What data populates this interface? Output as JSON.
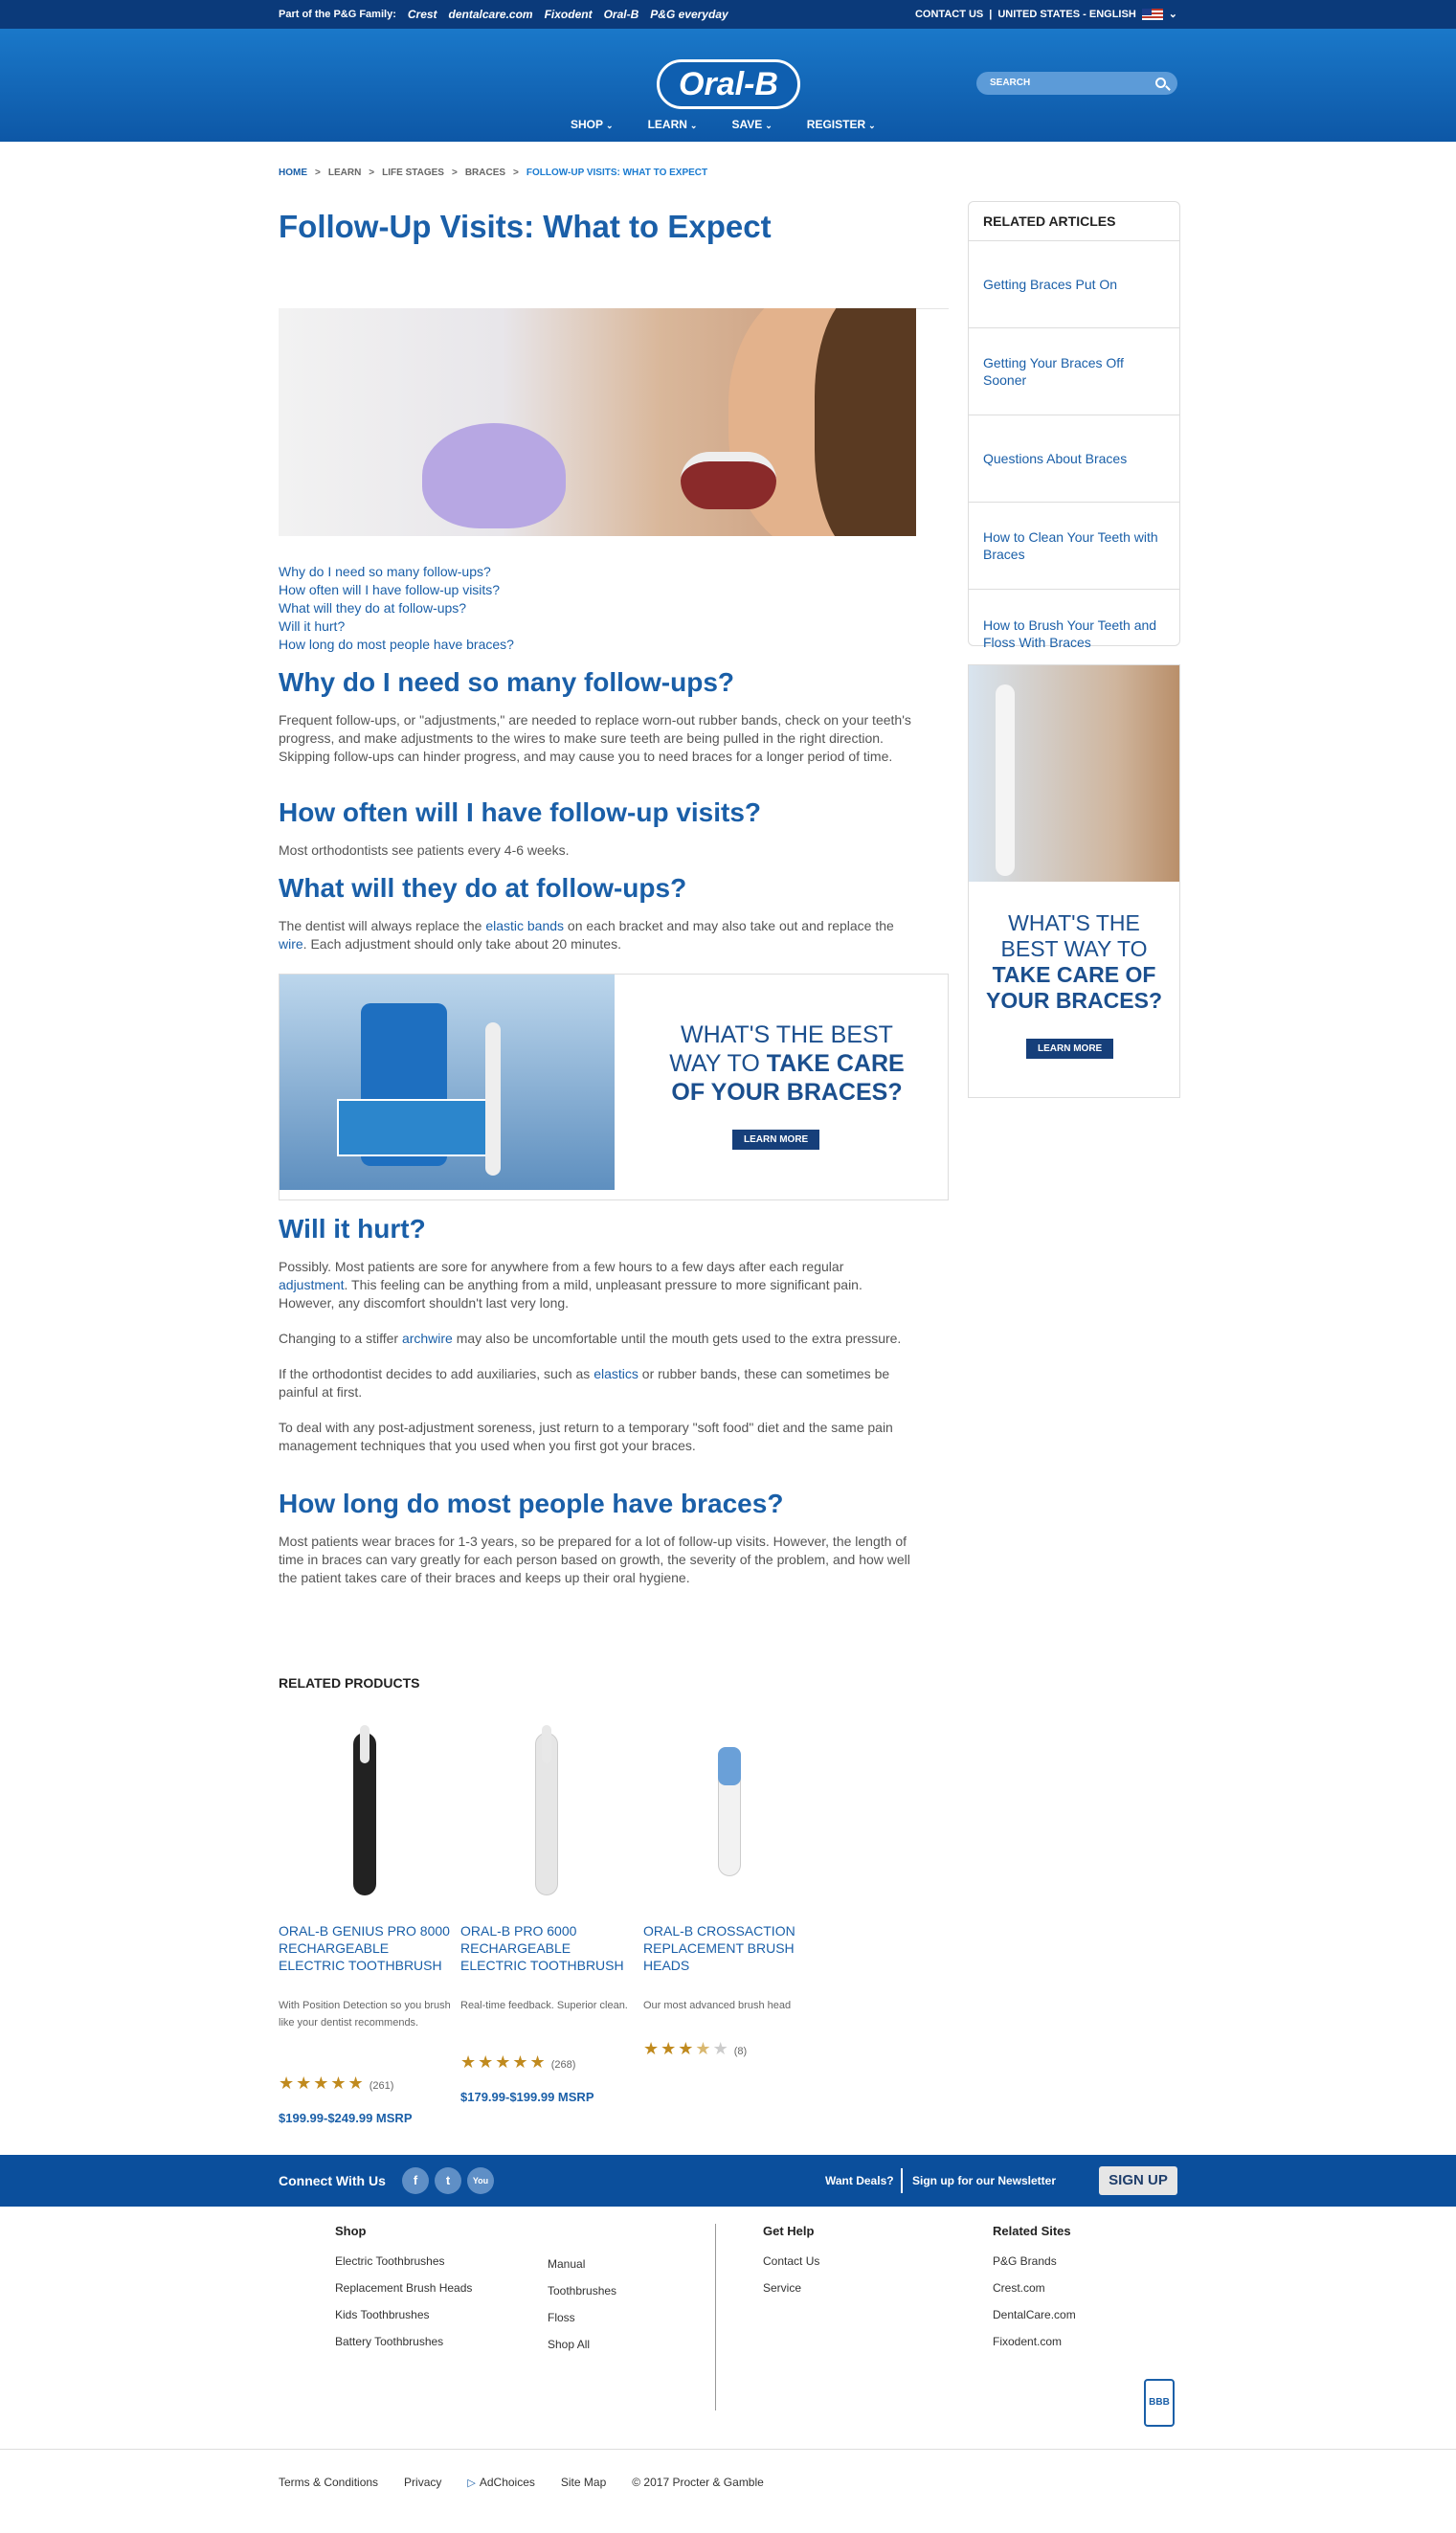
{
  "topstrip": {
    "family_label": "Part of the P&G Family:",
    "family_brands": [
      "Crest",
      "dentalcare.com",
      "Fixodent",
      "Oral-B",
      "P&G everyday"
    ],
    "contact": "CONTACT US",
    "locale": "UNITED STATES - ENGLISH"
  },
  "header": {
    "logo": "Oral-B",
    "search_placeholder": "SEARCH",
    "nav": [
      "SHOP",
      "LEARN",
      "SAVE",
      "REGISTER"
    ]
  },
  "breadcrumb": [
    "HOME",
    "LEARN",
    "LIFE STAGES",
    "BRACES",
    "FOLLOW-UP VISITS: WHAT TO EXPECT"
  ],
  "article": {
    "title": "Follow-Up Visits: What to Expect",
    "toc": [
      "Why do I need so many follow-ups?",
      "How often will I have follow-up visits?",
      "What will they do at follow-ups?",
      "Will it hurt?",
      "How long do most people have braces?"
    ],
    "s1_h": "Why do I need so many follow-ups?",
    "s1_p": "Frequent follow-ups, or \"adjustments,\" are needed to replace worn-out rubber bands, check on your teeth's progress, and make adjustments to the wires to make sure teeth are being pulled in the right direction. Skipping follow-ups can hinder progress, and may cause you to need braces for a longer period of time.",
    "s2_h": "How often will I have follow-up visits?",
    "s2_p": "Most orthodontists see patients every 4-6 weeks.",
    "s3_h": "What will they do at follow-ups?",
    "s3_p_a": "The dentist will always replace the ",
    "s3_link1": "elastic bands",
    "s3_p_b": " on each bracket and may also take out and replace the ",
    "s3_link2": "wire",
    "s3_p_c": ". Each adjustment should only take about 20 minutes.",
    "banner_line1": "WHAT'S THE BEST",
    "banner_line2a": "WAY TO ",
    "banner_line2b": "TAKE CARE",
    "banner_line3": "OF YOUR BRACES?",
    "banner_btn": "LEARN MORE",
    "s4_h": "Will it hurt?",
    "s4_p1_a": "Possibly. Most patients are sore for anywhere from a few hours to a few days after each regular ",
    "s4_p1_link": "adjustment",
    "s4_p1_b": ". This feeling can be anything from a mild, unpleasant pressure to more significant pain. However, any discomfort shouldn't last very long.",
    "s4_p2_a": "Changing to a stiffer ",
    "s4_p2_link": "archwire",
    "s4_p2_b": " may also be uncomfortable until the mouth gets used to the extra pressure.",
    "s4_p3_a": "If the orthodontist decides to add auxiliaries, such as ",
    "s4_p3_link": "elastics",
    "s4_p3_b": " or rubber bands, these can sometimes be painful at first.",
    "s4_p4": "To deal with any post-adjustment soreness, just return to a temporary \"soft food\" diet and the same pain management techniques that you used when you first got your braces.",
    "s5_h": "How long do most people have braces?",
    "s5_p": "Most patients wear braces for 1-3 years, so be prepared for a lot of follow-up visits. However, the length of time in braces can vary greatly for each person based on growth, the severity of the problem, and how well the patient takes care of their braces and keeps up their oral hygiene."
  },
  "sidebar": {
    "related_title": "RELATED ARTICLES",
    "related": [
      "Getting Braces Put On",
      "Getting Your Braces Off Sooner",
      "Questions About Braces",
      "How to Clean Your Teeth with Braces",
      "How to Brush Your Teeth and Floss With Braces"
    ],
    "ad_line1": "WHAT'S THE",
    "ad_line2": "BEST WAY TO",
    "ad_line3": "TAKE CARE OF",
    "ad_line4": "YOUR BRACES?",
    "ad_btn": "LEARN MORE"
  },
  "products": {
    "title": "RELATED PRODUCTS",
    "items": [
      {
        "name": "ORAL-B GENIUS PRO 8000 RECHARGEABLE ELECTRIC TOOTHBRUSH",
        "desc": "With Position Detection so you brush like your dentist recommends.",
        "rating": 5,
        "count": "(261)",
        "price": "$199.99-$249.99 MSRP",
        "color": "#222222"
      },
      {
        "name": "ORAL-B PRO 6000 RECHARGEABLE ELECTRIC TOOTHBRUSH",
        "desc": "Real-time feedback. Superior clean.",
        "rating": 5,
        "count": "(268)",
        "price": "$179.99-$199.99 MSRP",
        "color": "#e6e6e6"
      },
      {
        "name": "ORAL-B CROSSACTION REPLACEMENT BRUSH HEADS",
        "desc": "Our most advanced brush head",
        "rating": 3.5,
        "count": "(8)",
        "price": "",
        "color": "#f2f2f2"
      }
    ]
  },
  "connect": {
    "label": "Connect With Us",
    "social": [
      "f",
      "t",
      "You"
    ],
    "deals": "Want Deals?",
    "newsletter": "Sign up for our Newsletter",
    "signup": "SIGN UP"
  },
  "footer": {
    "shop_title": "Shop",
    "shop_col1": [
      "Electric Toothbrushes",
      "Replacement Brush Heads",
      "Kids Toothbrushes",
      "Battery Toothbrushes"
    ],
    "shop_col2": [
      "Manual",
      "Toothbrushes",
      "Floss",
      "Shop All"
    ],
    "help_title": "Get Help",
    "help": [
      "Contact Us",
      "Service"
    ],
    "sites_title": "Related Sites",
    "sites": [
      "P&G Brands",
      "Crest.com",
      "DentalCare.com",
      "Fixodent.com"
    ],
    "bbb": "BBB",
    "legal": [
      "Terms & Conditions",
      "Privacy",
      "AdChoices",
      "Site Map",
      "© 2017 Procter & Gamble"
    ]
  }
}
